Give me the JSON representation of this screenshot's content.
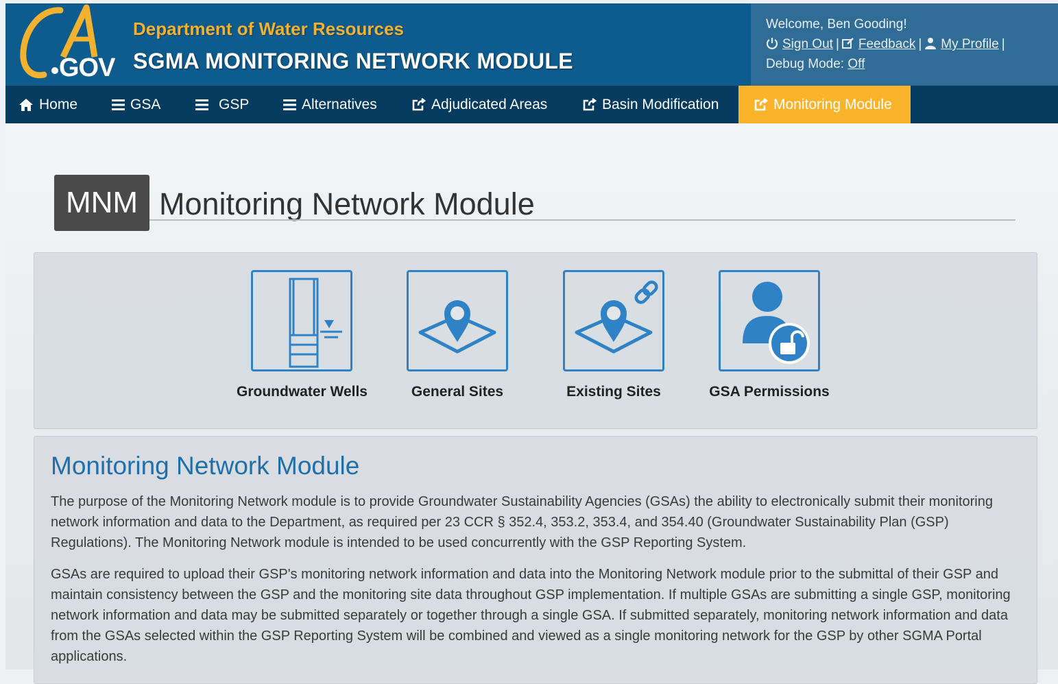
{
  "header": {
    "logo_text": "CA.GOV",
    "department": "Department of Water Resources",
    "app_title": "SGMA MONITORING NETWORK MODULE"
  },
  "user": {
    "welcome": "Welcome, Ben Gooding!",
    "sign_out": "Sign Out",
    "feedback": "Feedback",
    "my_profile": "My Profile",
    "separator": "|",
    "debug_label": "Debug Mode:",
    "debug_value": "Off"
  },
  "nav": {
    "items": [
      {
        "label": "Home",
        "icon": "home-icon"
      },
      {
        "label": "GSA",
        "icon": "list-icon"
      },
      {
        "label": "GSP",
        "icon": "list-icon"
      },
      {
        "label": "Alternatives",
        "icon": "list-icon"
      },
      {
        "label": "Adjudicated Areas",
        "icon": "external-link-icon"
      },
      {
        "label": "Basin Modification",
        "icon": "external-link-icon"
      },
      {
        "label": "Monitoring Module",
        "icon": "external-link-icon"
      }
    ],
    "active": "Monitoring Module"
  },
  "page": {
    "badge": "MNM",
    "heading": "Monitoring Network Module"
  },
  "tiles": [
    {
      "label": "Groundwater Wells",
      "icon": "well-icon"
    },
    {
      "label": "General Sites",
      "icon": "map-pin-icon"
    },
    {
      "label": "Existing Sites",
      "icon": "linked-site-icon"
    },
    {
      "label": "GSA Permissions",
      "icon": "user-unlock-icon"
    }
  ],
  "info": {
    "title": "Monitoring Network Module",
    "paragraph1": "The purpose of the Monitoring Network module is to provide Groundwater Sustainability Agencies (GSAs) the ability to electronically submit their monitoring network information and data to the Department, as required per 23 CCR § 352.4, 353.2, 353.4, and 354.40 (Groundwater Sustainability Plan (GSP) Regulations). The Monitoring Network module is intended to be used concurrently with the GSP Reporting System.",
    "paragraph2": "GSAs are required to upload their GSP's monitoring network information and data into the Monitoring Network module prior to the submittal of their GSP and maintain consistency between the GSP and the monitoring site data throughout GSP implementation. If multiple GSAs are submitting a single GSP, monitoring network information and data may be submitted separately or together through a single GSA. If submitted separately, monitoring network information and data from the GSAs selected within the GSP Reporting System will be combined and viewed as a single monitoring network for the GSP by other SGMA Portal applications."
  },
  "colors": {
    "header_bg": "#0e5b8e",
    "nav_bg": "#053b5e",
    "accent": "#fbb42a",
    "tile_blue": "#2f82c6",
    "title_blue": "#1f6fab"
  }
}
